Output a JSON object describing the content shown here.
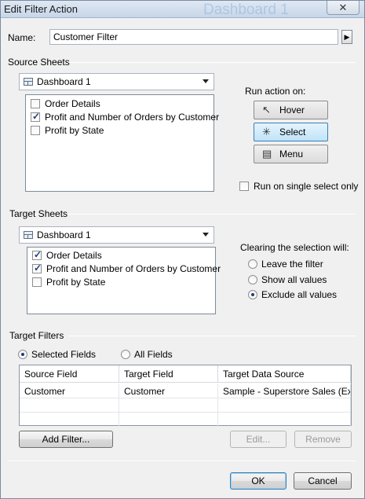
{
  "window": {
    "title": "Edit Filter Action",
    "background_text": "Dashboard 1",
    "close_label": "✕"
  },
  "name": {
    "label": "Name:",
    "value": "Customer Filter",
    "arrow": "▶"
  },
  "source": {
    "heading": "Source Sheets",
    "combo_value": "Dashboard 1",
    "items": [
      {
        "label": "Order Details",
        "checked": false
      },
      {
        "label": "Profit and Number of Orders by Customer",
        "checked": true
      },
      {
        "label": "Profit by State",
        "checked": false
      }
    ]
  },
  "run_action": {
    "heading": "Run action on:",
    "hover": "Hover",
    "select": "Select",
    "menu": "Menu",
    "single_select": "Run on single select only",
    "selected": "Select"
  },
  "target": {
    "heading": "Target Sheets",
    "combo_value": "Dashboard 1",
    "items": [
      {
        "label": "Order Details",
        "checked": true
      },
      {
        "label": "Profit and Number of Orders by Customer",
        "checked": true
      },
      {
        "label": "Profit by State",
        "checked": false
      }
    ]
  },
  "clearing": {
    "heading": "Clearing the selection will:",
    "leave": "Leave the filter",
    "show": "Show all values",
    "exclude": "Exclude all values",
    "selected": "Exclude all values"
  },
  "filters": {
    "heading": "Target Filters",
    "selected_fields": "Selected Fields",
    "all_fields": "All Fields",
    "mode": "Selected Fields",
    "columns": [
      "Source Field",
      "Target Field",
      "Target Data Source"
    ],
    "rows": [
      [
        "Customer",
        "Customer",
        "Sample - Superstore Sales (Ex..."
      ]
    ],
    "add_filter": "Add Filter...",
    "edit": "Edit...",
    "remove": "Remove"
  },
  "footer": {
    "ok": "OK",
    "cancel": "Cancel"
  },
  "colors": {
    "selected_button": "#bfe3f9",
    "title_bar": "#c7d6e8",
    "check_mark": "#1e3f7a"
  }
}
